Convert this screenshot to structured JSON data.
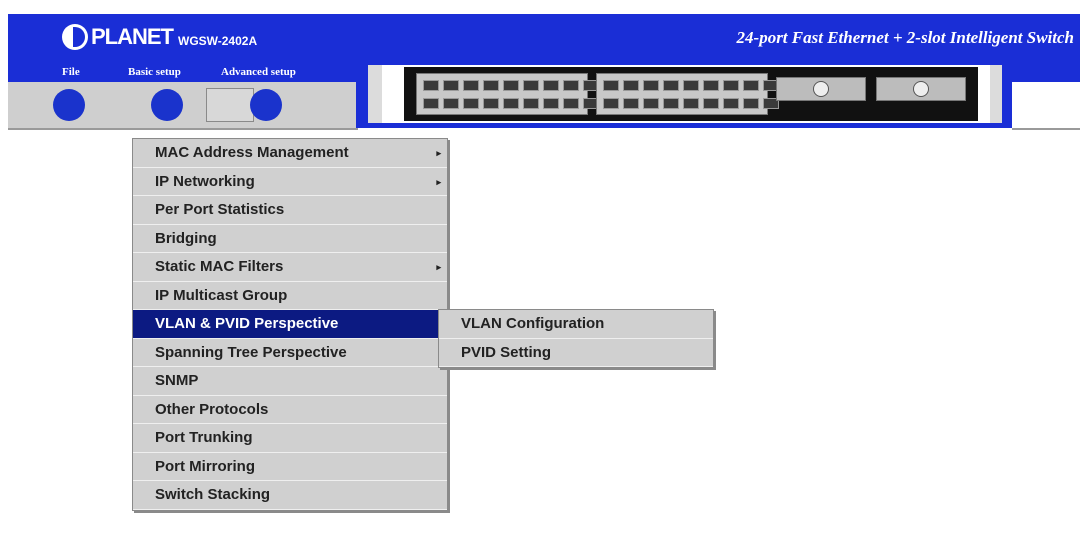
{
  "header": {
    "logo_text": "PLANET",
    "model": "WGSW-2402A",
    "tagline": "24-port Fast Ethernet + 2-slot Intelligent Switch"
  },
  "menubar": {
    "items": [
      "File",
      "Basic setup",
      "Advanced setup"
    ]
  },
  "colors": {
    "header_blue": "#1a2ed6",
    "menu_highlight": "#0c1a82",
    "menu_bg": "#d0d0d0"
  },
  "menu": {
    "items": [
      {
        "label": "MAC Address Management",
        "has_submenu": true
      },
      {
        "label": "IP Networking",
        "has_submenu": true
      },
      {
        "label": "Per Port Statistics",
        "has_submenu": false
      },
      {
        "label": "Bridging",
        "has_submenu": false
      },
      {
        "label": "Static MAC Filters",
        "has_submenu": true
      },
      {
        "label": "IP Multicast Group",
        "has_submenu": false
      },
      {
        "label": "VLAN & PVID Perspective",
        "has_submenu": true,
        "active": true
      },
      {
        "label": "Spanning Tree Perspective",
        "has_submenu": true
      },
      {
        "label": "SNMP",
        "has_submenu": false
      },
      {
        "label": "Other Protocols",
        "has_submenu": false
      },
      {
        "label": "Port Trunking",
        "has_submenu": false
      },
      {
        "label": "Port Mirroring",
        "has_submenu": false
      },
      {
        "label": "Switch Stacking",
        "has_submenu": false
      }
    ],
    "arrow": "▸"
  },
  "submenu": {
    "items": [
      {
        "label": "VLAN Configuration"
      },
      {
        "label": "PVID Setting"
      }
    ]
  }
}
